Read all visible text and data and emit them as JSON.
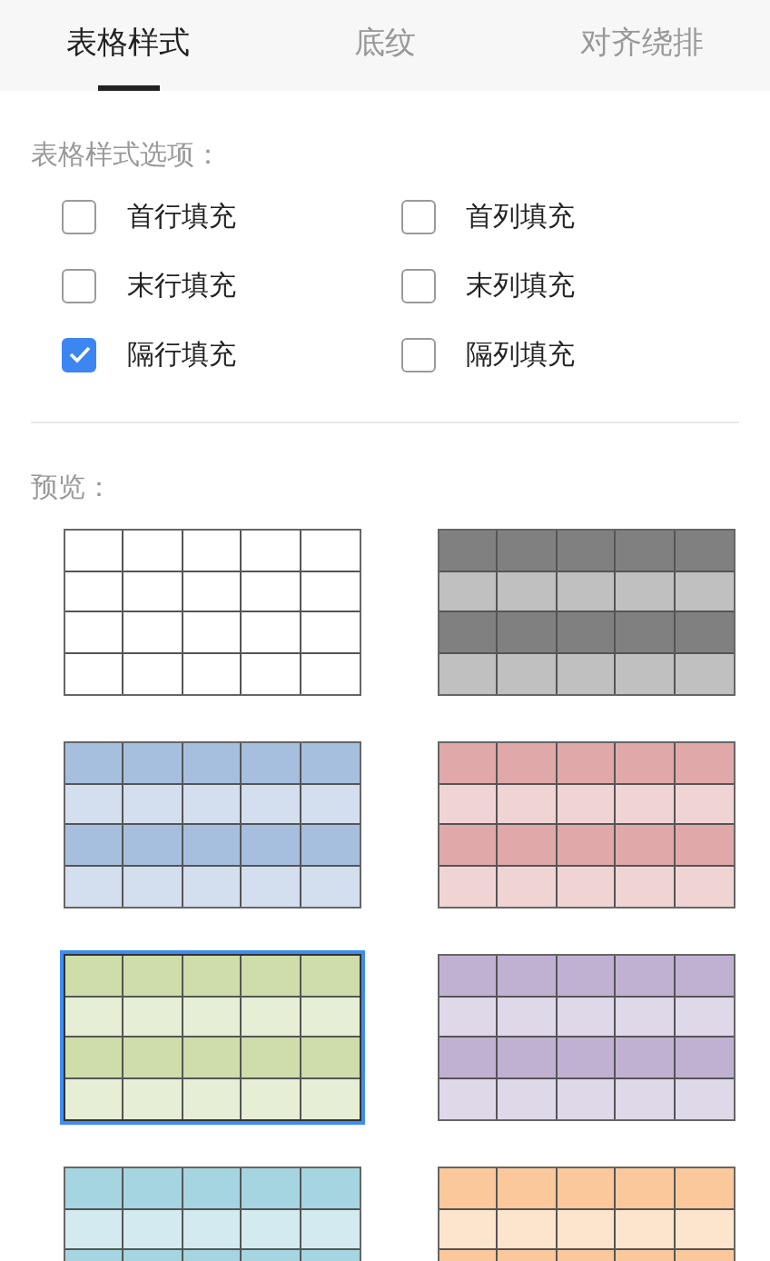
{
  "tabs": [
    {
      "label": "表格样式",
      "selected": true
    },
    {
      "label": "底纹",
      "selected": false
    },
    {
      "label": "对齐绕排",
      "selected": false
    }
  ],
  "options": {
    "title": "表格样式选项：",
    "items": [
      {
        "label": "首行填充",
        "checked": false
      },
      {
        "label": "首列填充",
        "checked": false
      },
      {
        "label": "末行填充",
        "checked": false
      },
      {
        "label": "末列填充",
        "checked": false
      },
      {
        "label": "隔行填充",
        "checked": true
      },
      {
        "label": "隔列填充",
        "checked": false
      }
    ]
  },
  "preview": {
    "title": "预览：",
    "styles": [
      {
        "rows": [
          {
            "color": "#ffffff"
          },
          {
            "color": "#ffffff"
          },
          {
            "color": "#ffffff"
          },
          {
            "color": "#ffffff"
          }
        ],
        "selected": false
      },
      {
        "rows": [
          {
            "color": "#808080"
          },
          {
            "color": "#c0c0c0"
          },
          {
            "color": "#808080"
          },
          {
            "color": "#c0c0c0"
          }
        ],
        "selected": false
      },
      {
        "rows": [
          {
            "color": "#a6bfdf"
          },
          {
            "color": "#d3dfee"
          },
          {
            "color": "#a6bfdf"
          },
          {
            "color": "#d3dfee"
          }
        ],
        "selected": false
      },
      {
        "rows": [
          {
            "color": "#e0a8a8"
          },
          {
            "color": "#f0d4d4"
          },
          {
            "color": "#e0a8a8"
          },
          {
            "color": "#f0d4d4"
          }
        ],
        "selected": false
      },
      {
        "rows": [
          {
            "color": "#cfddaa"
          },
          {
            "color": "#e6eed5"
          },
          {
            "color": "#cfddaa"
          },
          {
            "color": "#e6eed5"
          }
        ],
        "selected": true
      },
      {
        "rows": [
          {
            "color": "#c0b1d3"
          },
          {
            "color": "#dfd8e9"
          },
          {
            "color": "#c0b1d3"
          },
          {
            "color": "#dfd8e9"
          }
        ],
        "selected": false
      },
      {
        "rows": [
          {
            "color": "#a5d5e1"
          },
          {
            "color": "#d2eaf0"
          },
          {
            "color": "#a5d5e1"
          }
        ],
        "selected": false
      },
      {
        "rows": [
          {
            "color": "#fbc89c"
          },
          {
            "color": "#fde4cd"
          },
          {
            "color": "#fbc89c"
          }
        ],
        "selected": false
      }
    ]
  }
}
